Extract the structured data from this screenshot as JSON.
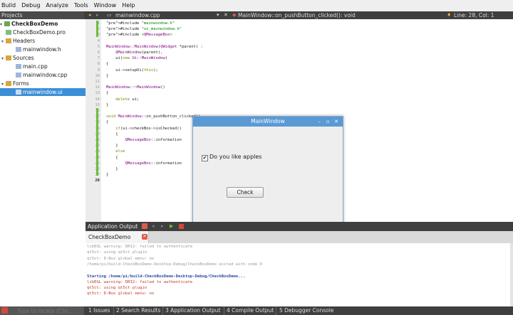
{
  "menubar": {
    "items": [
      "Build",
      "Debug",
      "Analyze",
      "Tools",
      "Window",
      "Help"
    ]
  },
  "toolbar": {
    "projects_combo": "Projects",
    "file_tab": "mainwindow.cpp",
    "function_combo": "MainWindow::on_pushButton_clicked(): void",
    "cursor_position": "Line: 28, Col: 1"
  },
  "sidebar": {
    "items": [
      {
        "label": "CheckBoxDemo",
        "bold": true
      },
      {
        "label": "CheckBoxDemo.pro"
      },
      {
        "label": "Headers"
      },
      {
        "label": "mainwindow.h"
      },
      {
        "label": "Sources"
      },
      {
        "label": "main.cpp"
      },
      {
        "label": "mainwindow.cpp"
      },
      {
        "label": "Forms"
      },
      {
        "label": "mainwindow.ui"
      }
    ]
  },
  "editor": {
    "line_numbers": [
      "1",
      "2",
      "3",
      "4",
      "5",
      "6",
      "7",
      "8",
      "9",
      "10",
      "11",
      "12",
      "13",
      "14",
      "15",
      "16",
      "17",
      "18",
      "19",
      "20",
      "21",
      "22",
      "23",
      "24",
      "25",
      "26",
      "27",
      "28"
    ],
    "current_line": "28",
    "lines": [
      "#include \"mainwindow.h\"",
      "#include \"ui_mainwindow.h\"",
      "#include <QMessageBox>",
      "",
      "MainWindow::MainWindow(QWidget *parent) :",
      "    QMainWindow(parent),",
      "    ui(new Ui::MainWindow)",
      "{",
      "    ui->setupUi(this);",
      "}",
      "",
      "MainWindow::~MainWindow()",
      "{",
      "    delete ui;",
      "}",
      "",
      "void MainWindow::on_pushButton_clicked()",
      "{",
      "    if(ui->checkBox->isChecked()",
      "    {",
      "        QMessageBox::information",
      "    }",
      "    else",
      "    {",
      "        QMessageBox::information",
      "    }",
      "}",
      ""
    ]
  },
  "dialog": {
    "title": "MainWindow",
    "checkbox_label": "Do you like apples",
    "checkbox_checked": true,
    "button_label": "Check"
  },
  "output": {
    "pane_title": "Application Output",
    "tab_label": "CheckBoxDemo",
    "lines": [
      {
        "text": "libEGL warning: DRI2: failed to authenticate",
        "style": "gray"
      },
      {
        "text": "qt5ct: using qt5ct plugin",
        "style": "gray"
      },
      {
        "text": "qt5ct: D-Bus global menu: no",
        "style": "gray"
      },
      {
        "text": "/home/pi/build-CheckBoxDemo-Desktop-Debug/CheckBoxDemo exited with code 0",
        "style": "gray"
      },
      {
        "text": "",
        "style": "gray"
      },
      {
        "text": "Starting /home/pi/build-CheckBoxDemo-Desktop-Debug/CheckBoxDemo...",
        "style": "blue"
      },
      {
        "text": "libEGL warning: DRI2: failed to authenticate",
        "style": "red"
      },
      {
        "text": "qt5ct: using qt5ct plugin",
        "style": "red"
      },
      {
        "text": "qt5ct: D-Bus global menu: no",
        "style": "red"
      }
    ]
  },
  "statusbar": {
    "locate_placeholder": "Type to locate (Ctrl...",
    "items": [
      "1 Issues",
      "2 Search Results",
      "3 Application Output",
      "4 Compile Output",
      "5 Debugger Console"
    ]
  },
  "colors": {
    "accent": "#3b8fd6",
    "dialog_title": "#5a9ad4",
    "dark_bar": "#3f3f3f",
    "close_red": "#e05a4a"
  }
}
